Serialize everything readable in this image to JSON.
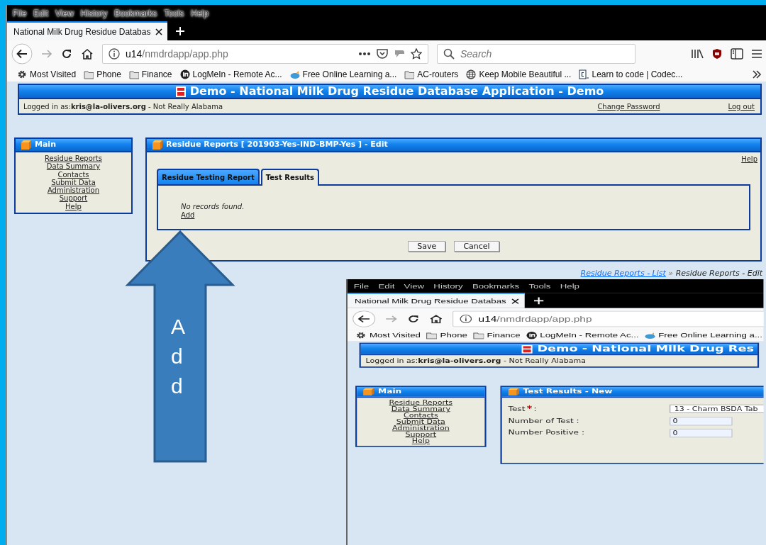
{
  "browser": {
    "menu": [
      "File",
      "Edit",
      "View",
      "History",
      "Bookmarks",
      "Tools",
      "Help"
    ],
    "tab": {
      "title": "National Milk Drug Residue Databas"
    },
    "url": {
      "host": "u14",
      "path": "/nmdrdapp/app.php"
    },
    "search": {
      "placeholder": "Search"
    },
    "bookmarks": [
      {
        "label": "Most Visited",
        "kind": "gear"
      },
      {
        "label": "Phone",
        "kind": "folder"
      },
      {
        "label": "Finance",
        "kind": "folder"
      },
      {
        "label": "LogMeIn - Remote Ac...",
        "kind": "logmein"
      },
      {
        "label": "Free Online Learning a...",
        "kind": "fish"
      },
      {
        "label": "AC-routers",
        "kind": "folder"
      },
      {
        "label": "Keep Mobile Beautiful ...",
        "kind": "globe"
      },
      {
        "label": "Learn to code | Codec...",
        "kind": "code"
      }
    ]
  },
  "app": {
    "title": "Demo - National Milk Drug Residue Database Application - Demo",
    "session": "Logged in as:**kris@la-olivers.org** - Not Really Alabama",
    "links": [
      "Change Password",
      "Log out"
    ],
    "sidebar": {
      "title": "Main",
      "items": [
        "Residue Reports",
        "Data Summary",
        "Contacts",
        "Submit Data",
        "Administration",
        "Support",
        "Help"
      ]
    },
    "panel": {
      "kind": "tabs",
      "title": "Residue Reports [ 201903-Yes-IND-BMP-Yes ] - Edit",
      "help": "Help",
      "tabs": [
        {
          "label": "Residue Testing Report",
          "selected": false
        },
        {
          "label": "Test Results",
          "selected": true
        }
      ],
      "message": "No records found.",
      "add_link": "Add",
      "buttons": [
        "Save",
        "Cancel"
      ]
    },
    "breadcrumb": {
      "trail": "Residue Reports - List",
      "separator": "»",
      "current": "Residue Reports - Edit"
    }
  },
  "callout": {
    "label": "Add"
  },
  "inset": {
    "browser": {
      "menu": [
        "File",
        "Edit",
        "View",
        "History",
        "Bookmarks",
        "Tools",
        "Help"
      ],
      "tab": {
        "title": "National Milk Drug Residue Databas"
      },
      "url": {
        "host": "u14",
        "path": "/nmdrdapp/app.php"
      },
      "bookmarks": [
        {
          "label": "Most Visited",
          "kind": "gear"
        },
        {
          "label": "Phone",
          "kind": "folder"
        },
        {
          "label": "Finance",
          "kind": "folder"
        },
        {
          "label": "LogMeIn - Remote Ac...",
          "kind": "logmein"
        },
        {
          "label": "Free Online Learning a...",
          "kind": "fish"
        }
      ]
    },
    "app": {
      "title": "Demo - National Milk Drug Res",
      "session": "Logged in as:**kris@la-olivers.org** - Not Really Alabama",
      "sidebar": {
        "title": "Main",
        "items": [
          "Residue Reports",
          "Data Summary",
          "Contacts",
          "Submit Data",
          "Administration",
          "Support",
          "Help"
        ]
      },
      "panel": {
        "kind": "form",
        "title": "Test Results - New",
        "fields": [
          {
            "label": "Test",
            "required_mark": "*",
            "label_end": ":",
            "value": "13 - Charm BSDA Tab",
            "kind": "select"
          },
          {
            "label": "Number of Test :",
            "value": "0",
            "kind": "text"
          },
          {
            "label": "Number Positive :",
            "value": "0",
            "kind": "text"
          }
        ]
      }
    }
  }
}
